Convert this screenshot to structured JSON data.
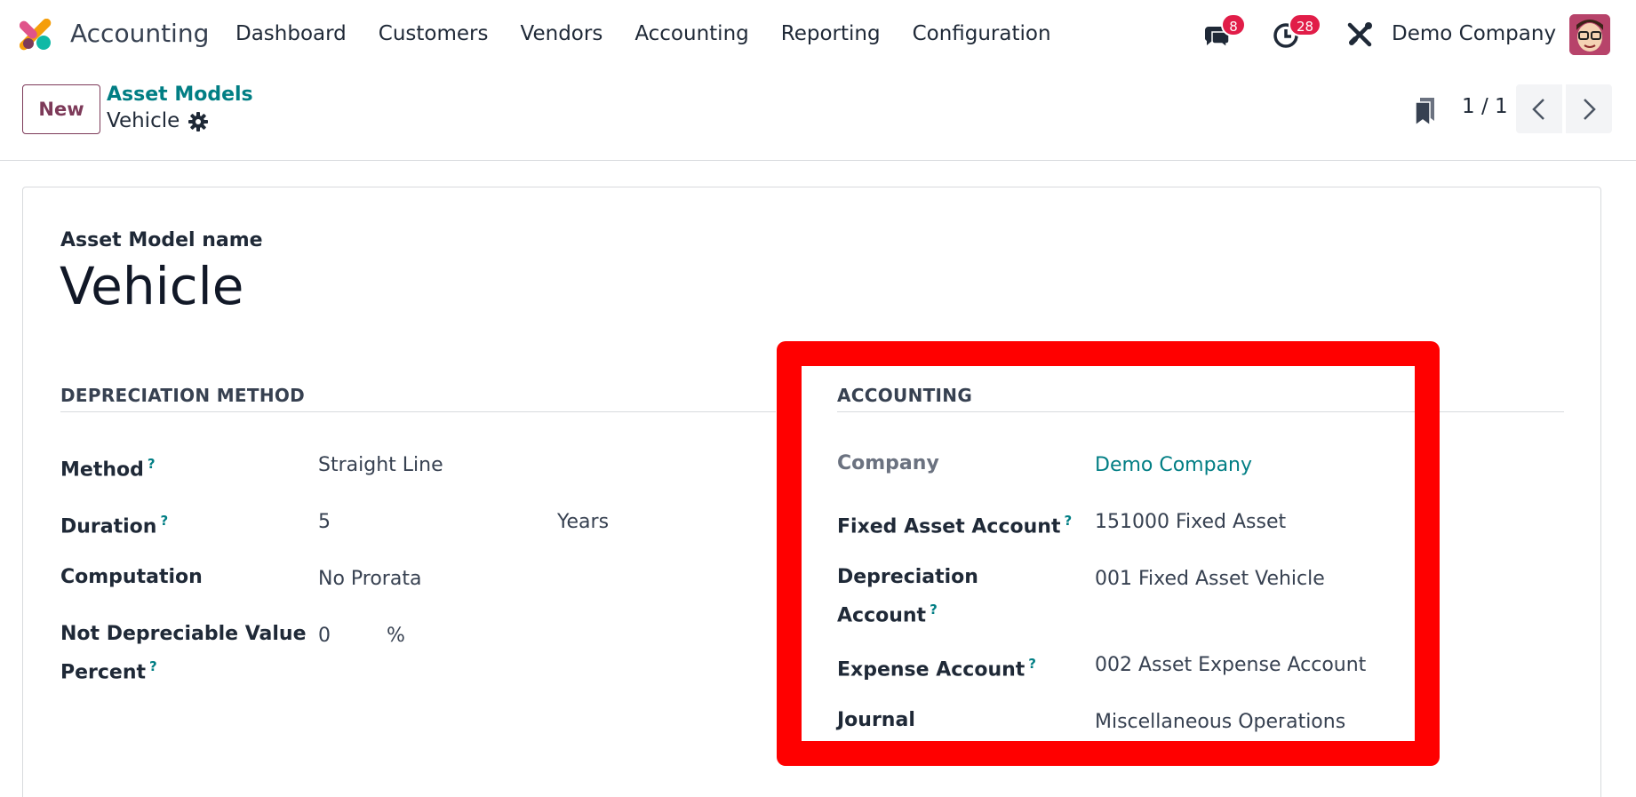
{
  "navbar": {
    "app_name": "Accounting",
    "menu": [
      "Dashboard",
      "Customers",
      "Vendors",
      "Accounting",
      "Reporting",
      "Configuration"
    ],
    "messages_badge": "8",
    "activities_badge": "28",
    "company": "Demo Company"
  },
  "control_panel": {
    "new_label": "New",
    "breadcrumb_parent": "Asset Models",
    "breadcrumb_current": "Vehicle",
    "pager": "1 / 1"
  },
  "form": {
    "name_label": "Asset Model name",
    "name_value": "Vehicle",
    "depreciation": {
      "title": "DEPRECIATION METHOD",
      "method_label": "Method",
      "method_value": "Straight Line",
      "duration_label": "Duration",
      "duration_value": "5",
      "duration_unit": "Years",
      "computation_label": "Computation",
      "computation_value": "No Prorata",
      "not_depreciable_label_line1": "Not Depreciable Value",
      "not_depreciable_label_line2": "Percent",
      "not_depreciable_value": "0",
      "not_depreciable_unit": "%"
    },
    "accounting": {
      "title": "ACCOUNTING",
      "company_label": "Company",
      "company_value": "Demo Company",
      "fixed_asset_label": "Fixed Asset Account",
      "fixed_asset_value": "151000 Fixed Asset",
      "depreciation_label_line1": "Depreciation",
      "depreciation_label_line2": "Account",
      "depreciation_value": "001 Fixed Asset Vehicle",
      "expense_label": "Expense Account",
      "expense_value": "002 Asset Expense Account",
      "journal_label": "Journal",
      "journal_value": "Miscellaneous Operations"
    }
  },
  "help_marker": "?",
  "colors": {
    "brand": "#017e84",
    "primary": "#7d3a59",
    "badge": "#e11d48",
    "highlight": "#ff0000"
  },
  "icons": [
    "app-logo-icon",
    "chat-icon",
    "clock-icon",
    "tools-icon",
    "gear-icon",
    "bookmark-icon",
    "chevron-left-icon",
    "chevron-right-icon"
  ]
}
